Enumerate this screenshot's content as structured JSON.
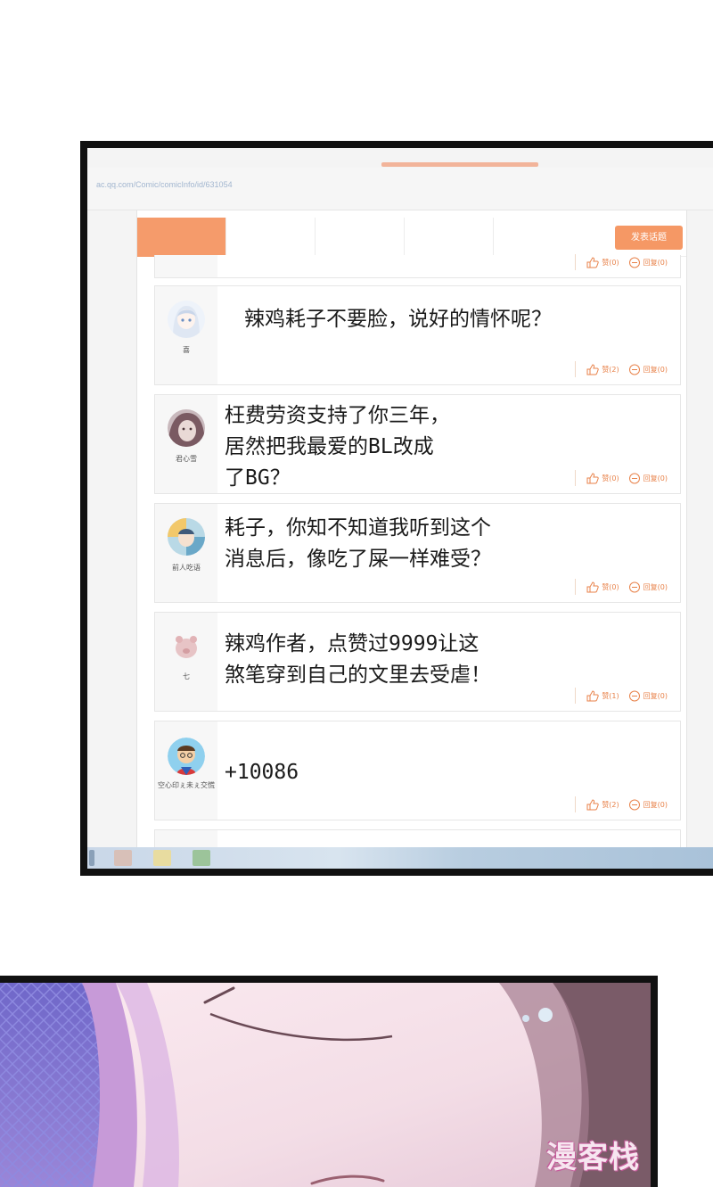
{
  "browser": {
    "url": "ac.qq.com/Comic/comicInfo/id/631054",
    "post_button": "发表话题"
  },
  "comments": [
    {
      "user": "",
      "text": "",
      "like_label": "赞(0)",
      "reply_label": "回复(0)"
    },
    {
      "user": "喜",
      "text": "辣鸡耗子不要脸，说好的情怀呢？",
      "like_label": "赞(2)",
      "reply_label": "回复(0)"
    },
    {
      "user": "君心雪",
      "text": "枉费劳资支持了你三年，\n居然把我最爱的BL改成\n了BG？",
      "like_label": "赞(0)",
      "reply_label": "回复(0)"
    },
    {
      "user": "前人吃语",
      "text": "耗子，你知不知道我听到这个\n消息后，像吃了屎一样难受？",
      "like_label": "赞(0)",
      "reply_label": "回复(0)"
    },
    {
      "user": "七",
      "text": "辣鸡作者，点赞过9999让这\n煞笔穿到自己的文里去受虐！",
      "like_label": "赞(1)",
      "reply_label": "回复(0)"
    },
    {
      "user": "空心印ぇ未ぇ交慌",
      "text": "+10086",
      "like_label": "赞(2)",
      "reply_label": "回复(0)"
    }
  ],
  "icons": {
    "like": "thumbs-up-icon",
    "reply": "speech-bubble-icon"
  },
  "colors": {
    "accent": "#f59865",
    "action_text": "#e8824a"
  },
  "watermark": "漫客栈"
}
